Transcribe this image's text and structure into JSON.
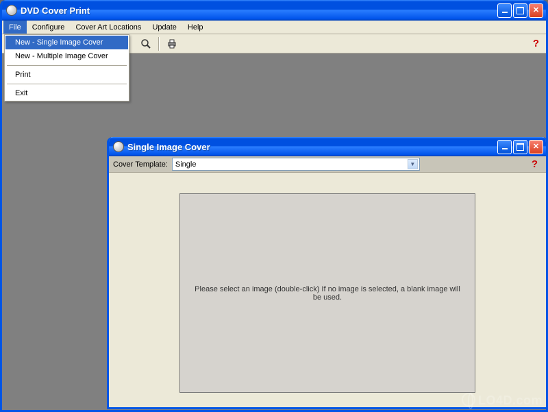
{
  "main": {
    "title": "DVD Cover Print",
    "menubar": [
      "File",
      "Configure",
      "Cover Art Locations",
      "Update",
      "Help"
    ],
    "file_menu": {
      "items": [
        "New - Single Image Cover",
        "New - Multiple Image Cover",
        "Print",
        "Exit"
      ]
    }
  },
  "child": {
    "title": "Single Image Cover",
    "template_label": "Cover Template:",
    "template_value": "Single",
    "placeholder_text": "Please select an image (double-click)  If no image is selected, a blank image will be used."
  },
  "watermark": "LO4D.com"
}
